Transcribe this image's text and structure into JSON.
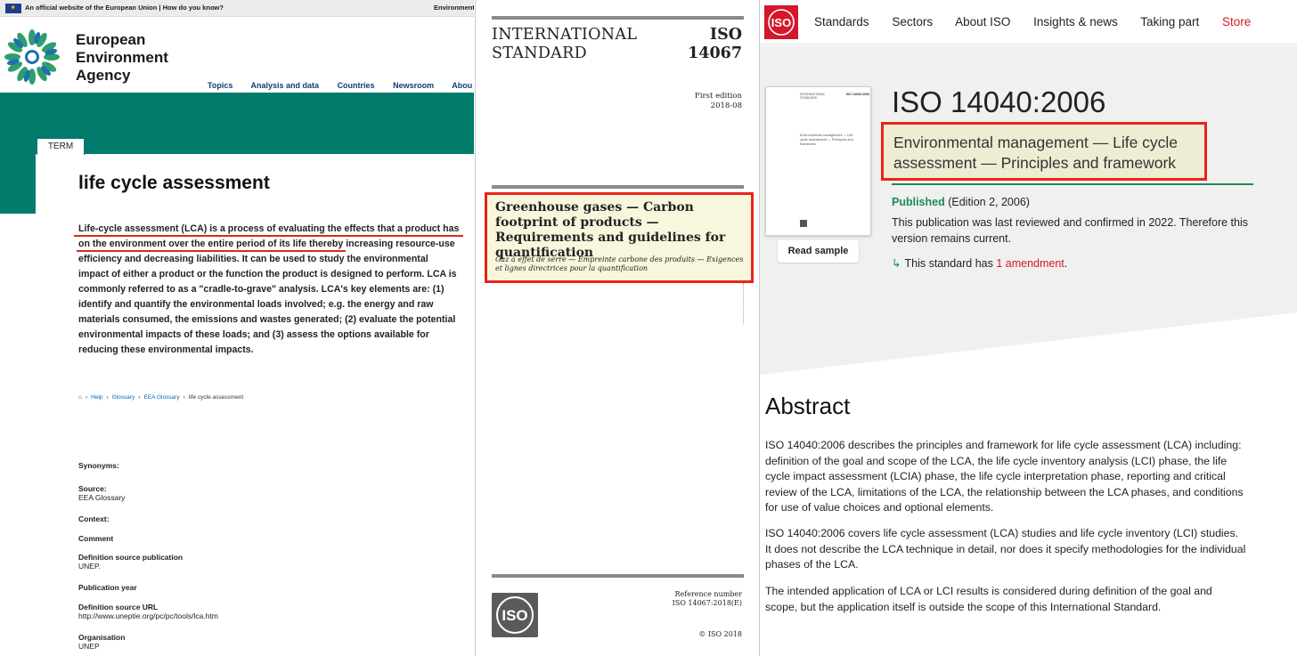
{
  "eea": {
    "official_text": "An official website of the European Union | How do you know?",
    "official_right": "Environmental i",
    "brand": [
      "European",
      "Environment",
      "Agency"
    ],
    "nav": [
      "Topics",
      "Analysis and data",
      "Countries",
      "Newsroom",
      "Abou"
    ],
    "term_tag": "TERM",
    "title": "life cycle assessment",
    "definition_underlined": "Life-cycle assessment (LCA) is a process of evaluating the effects that a product has on the environment over the entire period of its life",
    "definition_rest": " thereby increasing resource-use efficiency and decreasing liabilities. It can be used to study the environmental impact of either a product or the function the product is designed to perform. LCA is commonly referred to as a \"cradle-to-grave\" analysis. LCA's key elements are: (1) identify and quantify the environmental loads involved; e.g. the energy and raw materials consumed, the emissions and wastes generated; (2) evaluate the potential environmental impacts of these loads; and (3) assess the options available for reducing these environmental impacts.",
    "breadcrumbs": [
      "Help",
      "Glossary",
      "EEA Glossary",
      "life cycle assessment"
    ],
    "meta": {
      "synonyms_label": "Synonyms:",
      "source_label": "Source:",
      "source_value": "EEA Glossary",
      "context_label": "Context:",
      "comment_label": "Comment",
      "def_pub_label": "Definition source publication",
      "def_pub_value": "UNEP.",
      "pub_year_label": "Publication year",
      "def_url_label": "Definition source URL",
      "def_url_value": "http://www.uneptie.org/pc/pc/tools/lca.htm",
      "org_label": "Organisation",
      "org_value": "UNEP"
    }
  },
  "cover": {
    "intl_line1": "INTERNATIONAL",
    "intl_line2": "STANDARD",
    "iso_line1": "ISO",
    "iso_line2": "14067",
    "edition_line1": "First edition",
    "edition_line2": "2018-08",
    "title_en": "Greenhouse gases — Carbon footprint of products — Requirements and guidelines for quantification",
    "title_fr": "Gaz à effet de serre — Empreinte carbone des produits — Exigences et lignes directrices pour la quantification",
    "ref_label": "Reference number",
    "ref_value": "ISO 14067:2018(E)",
    "copyright": "© ISO 2018",
    "logo_text": "ISO"
  },
  "isoweb": {
    "logo_text": "ISO",
    "menu": [
      "Standards",
      "Sectors",
      "About ISO",
      "Insights & news",
      "Taking part",
      "Store"
    ],
    "standard_id": "ISO 14040:2006",
    "standard_title": "Environmental management — Life cycle assessment — Principles and framework",
    "status_label": "Published",
    "status_edition": "(Edition 2, 2006)",
    "reviewed": "This publication was last reviewed and confirmed in 2022. Therefore this version remains current.",
    "amend_prefix": "This standard has ",
    "amend_link": "1 amendment",
    "amend_suffix": ".",
    "read_sample": "Read sample",
    "thumb": {
      "intl": "INTERNATIONAL STANDARD",
      "iso": "ISO 14040:2006",
      "title": "Environmental management — Life cycle assessment — Principles and framework"
    },
    "abstract_heading": "Abstract",
    "abstract_paragraphs": [
      "ISO 14040:2006 describes the principles and framework for life cycle assessment (LCA) including: definition of the goal and scope of the LCA, the life cycle inventory analysis (LCI) phase, the life cycle impact assessment (LCIA) phase, the life cycle interpretation phase, reporting and critical review of the LCA, limitations of the LCA, the relationship between the LCA phases, and conditions for use of value choices and optional elements.",
      "ISO 14040:2006 covers life cycle assessment (LCA) studies and life cycle inventory (LCI) studies. It does not describe the LCA technique in detail, nor does it specify methodologies for the individual phases of the LCA.",
      "The intended application of LCA or LCI results is considered during definition of the goal and scope, but the application itself is outside the scope of this International Standard."
    ]
  },
  "colors": {
    "eea_teal": "#007b6c",
    "highlight_red": "#e8241a",
    "iso_red": "#d4172a",
    "published_green": "#1a8a5c"
  }
}
